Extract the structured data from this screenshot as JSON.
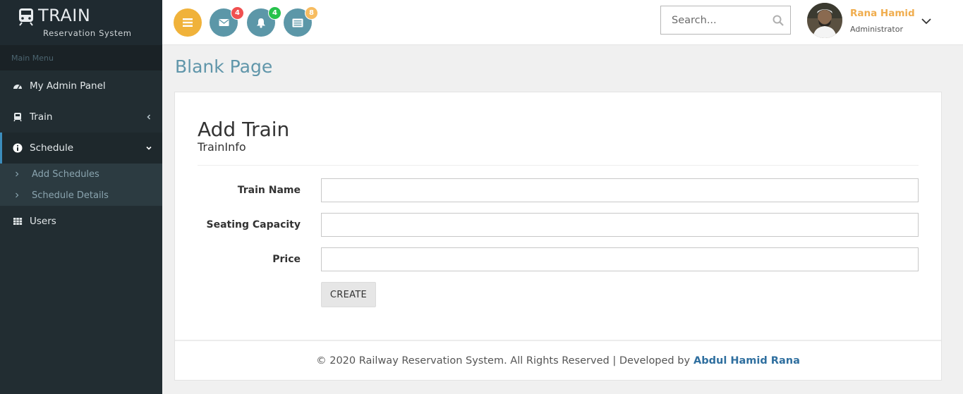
{
  "brand": {
    "title": "TRAIN",
    "subtitle": "Reservation System"
  },
  "sidebar": {
    "header": "Main Menu",
    "items": [
      {
        "label": "My Admin Panel",
        "icon": "dashboard-icon"
      },
      {
        "label": "Train",
        "icon": "train-icon"
      },
      {
        "label": "Schedule",
        "icon": "info-icon"
      },
      {
        "label": "Users",
        "icon": "grid-icon"
      }
    ],
    "submenu": [
      {
        "label": "Add Schedules"
      },
      {
        "label": "Schedule Details"
      }
    ]
  },
  "topbar": {
    "badges": {
      "messages": "4",
      "notifications": "4",
      "tasks": "8"
    },
    "search_placeholder": "Search...",
    "user": {
      "name": "Rana Hamid",
      "role": "Administrator"
    }
  },
  "page": {
    "title": "Blank Page",
    "form_title": "Add Train",
    "form_subtitle": "TrainInfo",
    "fields": {
      "train_name": "Train Name",
      "seating_capacity": "Seating Capacity",
      "price": "Price"
    },
    "submit_label": "CREATE"
  },
  "footer": {
    "text": "© 2020 Railway Reservation System. All Rights Reserved | Developed by",
    "author": "Abdul Hamid Rana"
  },
  "colors": {
    "sidebar_bg": "#222d32",
    "accent_orange": "#f0b23a",
    "teal": "#5c97a8",
    "title_blue": "#6096aa",
    "link_blue": "#2f6f9f"
  }
}
